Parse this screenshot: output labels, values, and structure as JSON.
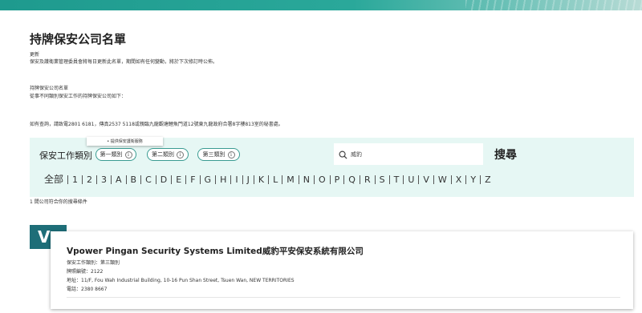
{
  "page": {
    "title": "持牌保安公司名單",
    "update_heading": "更新",
    "update_text": "保安及護衛業管理委員會將每日更新此名單，期間如有任何變動，將於下次修訂時公佈。",
    "list_heading": "持牌保安公司名單",
    "list_text": "從事不同類別保安工作的持牌保安公司如下：",
    "enquiry_text": "如有查詢，請致電2801 6181，傳真2537 5118或親臨九龍觀塘鯉魚門道12號東九龍政府合署8字樓813室的秘書處。"
  },
  "search": {
    "category_label": "保安工作類別",
    "categories": [
      {
        "label": "第一類別",
        "info_icon": "info-icon"
      },
      {
        "label": "第二類別",
        "info_icon": "info-icon"
      },
      {
        "label": "第三類別",
        "info_icon": "info-icon"
      }
    ],
    "tooltip": "• 提供保安護衛服務",
    "input_value": "威豹",
    "button_label": "搜尋",
    "alphabet": [
      "全部",
      "1",
      "2",
      "3",
      "A",
      "B",
      "C",
      "D",
      "E",
      "F",
      "G",
      "H",
      "I",
      "J",
      "K",
      "L",
      "M",
      "N",
      "O",
      "P",
      "Q",
      "R",
      "S",
      "T",
      "U",
      "V",
      "W",
      "X",
      "Y",
      "Z"
    ]
  },
  "results": {
    "count_text": "1 間公司符合你的搜尋條件",
    "items": [
      {
        "logo_letter": "V",
        "name": "Vpower Pingan Security Systems Limited威豹平安保安系統有限公司",
        "category": "保安工作類別：第三類別",
        "licence": "牌照編號：2122",
        "address": "地址：11/F, Fou Wah Industrial Building, 10-16 Pun Shan Street, Tsuen Wan, NEW TERRITORIES",
        "phone": "電話：2380 8667"
      }
    ]
  },
  "colors": {
    "banner": "#2aa89a",
    "panel_bg": "#e6f7f4",
    "logo_bg": "#1e6e78",
    "accent_border": "#3a9c92"
  }
}
